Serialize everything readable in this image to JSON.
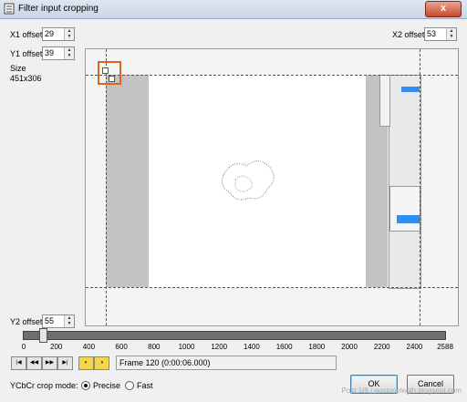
{
  "window": {
    "title": "Filter input cropping",
    "close_label": "x"
  },
  "fields": {
    "x1": {
      "label": "X1 offset",
      "value": "29"
    },
    "y1": {
      "label": "Y1 offset",
      "value": "39"
    },
    "x2": {
      "label": "X2 offset",
      "value": "53"
    },
    "y2": {
      "label": "Y2 offset",
      "value": "55"
    },
    "size_label": "Size",
    "size_value": "451x306"
  },
  "slider": {
    "ticks": [
      "0",
      "200",
      "400",
      "600",
      "800",
      "1000",
      "1200",
      "1400",
      "1600",
      "1800",
      "2000",
      "2200",
      "2400",
      "2588"
    ],
    "position": 120,
    "max": 2588
  },
  "frame": {
    "text": "Frame 120 (0:00:06.000)"
  },
  "crop_mode": {
    "label": "YCbCr crop mode:",
    "options": [
      "Precise",
      "Fast"
    ],
    "selected": "Precise"
  },
  "buttons": {
    "ok": "OK",
    "cancel": "Cancel"
  },
  "watermark": "Post 1/8 | postonelegth.blogspot.com",
  "colors": {
    "handle": "#e5621a",
    "accent": "#3c7fb1"
  }
}
